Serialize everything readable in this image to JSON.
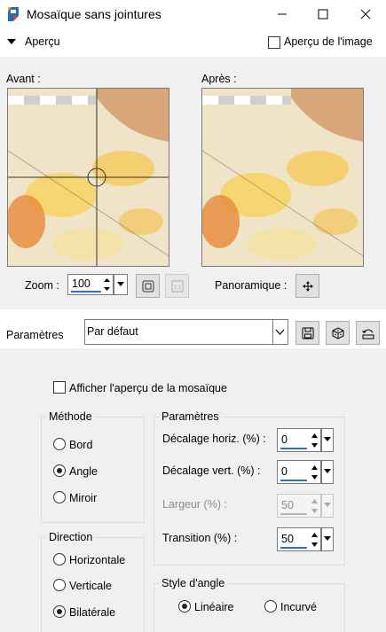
{
  "window": {
    "title": "Mosaïque sans jointures",
    "icons": [
      "app-icon",
      "minimize-icon",
      "maximize-icon",
      "close-icon"
    ]
  },
  "preview": {
    "header_label": "Aperçu",
    "image_preview_label": "Aperçu de l'image",
    "before_label": "Avant :",
    "after_label": "Après :",
    "zoom_label": "Zoom :",
    "zoom_value": "100",
    "pan_label": "Panoramique :"
  },
  "presets": {
    "label": "Paramètres",
    "selected": "Par défaut"
  },
  "show_mosaic_preview_label": "Afficher l'aperçu de la mosaïque",
  "method": {
    "title": "Méthode",
    "options": [
      "Bord",
      "Angle",
      "Miroir"
    ],
    "selected": "Angle"
  },
  "direction": {
    "title": "Direction",
    "options": [
      "Horizontale",
      "Verticale",
      "Bilatérale"
    ],
    "selected": "Bilatérale"
  },
  "params": {
    "title": "Paramètres",
    "h_offset_label": "Décalage horiz. (%) :",
    "h_offset_value": "0",
    "v_offset_label": "Décalage vert. (%) :",
    "v_offset_value": "0",
    "width_label": "Largeur (%) :",
    "width_value": "50",
    "transition_label": "Transition (%) :",
    "transition_value": "50"
  },
  "corner_style": {
    "title": "Style d'angle",
    "options": [
      "Linéaire",
      "Incurvé"
    ],
    "selected": "Linéaire"
  },
  "colors": {
    "accent_underline": "#2b73c8",
    "titlebar_bg": "#ffffff",
    "dialog_bg": "#f0f0f0"
  }
}
